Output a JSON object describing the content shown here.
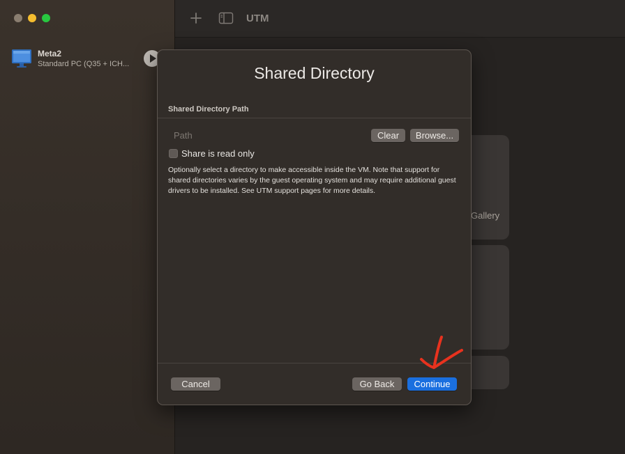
{
  "window": {
    "title": "UTM"
  },
  "sidebar": {
    "vm": {
      "name": "Meta2",
      "description": "Standard PC (Q35 + ICH..."
    }
  },
  "background": {
    "gallery_text": "Gallery"
  },
  "dialog": {
    "title": "Shared Directory",
    "section_header": "Shared Directory Path",
    "path_placeholder": "Path",
    "clear_label": "Clear",
    "browse_label": "Browse...",
    "readonly_label": "Share is read only",
    "readonly_checked": false,
    "help_text": "Optionally select a directory to make accessible inside the VM. Note that support for shared directories varies by the guest operating system and may require additional guest drivers to be installed. See UTM support pages for more details.",
    "cancel_label": "Cancel",
    "back_label": "Go Back",
    "continue_label": "Continue"
  },
  "colors": {
    "accent": "#1a6fdf",
    "annotation": "#e8321e"
  }
}
